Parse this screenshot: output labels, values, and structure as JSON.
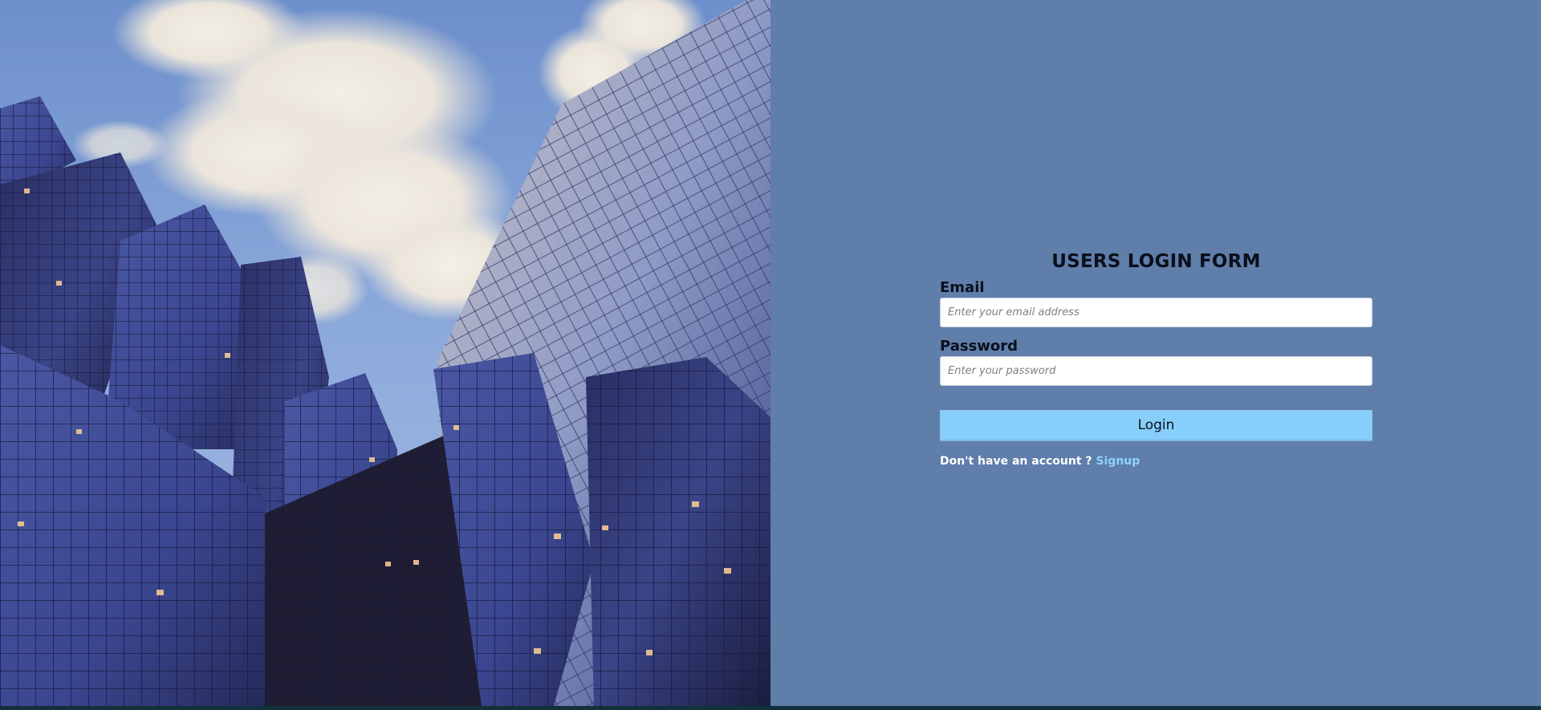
{
  "hero": {
    "image_subject": "glass-skyscrapers-against-cloudy-sky"
  },
  "form": {
    "title": "USERS LOGIN FORM",
    "email": {
      "label": "Email",
      "placeholder": "Enter your email address",
      "value": ""
    },
    "password": {
      "label": "Password",
      "placeholder": "Enter your password",
      "value": ""
    },
    "login_button": "Login",
    "signup_prompt": "Don't have an account ?",
    "signup_link": "Signup"
  },
  "colors": {
    "panel_background": "#5f7eaa",
    "button_background": "#87cefb",
    "link_color": "#8fd2fb",
    "title_color": "#0b0f1c"
  }
}
